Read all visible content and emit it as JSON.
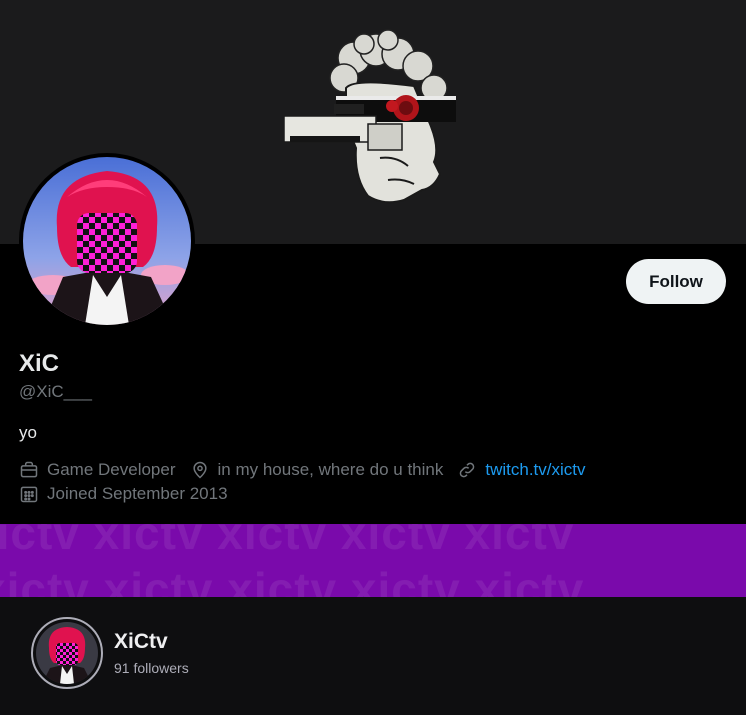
{
  "profile": {
    "display_name": "XiC",
    "handle": "@XiC___",
    "bio": "yo",
    "follow_label": "Follow",
    "profession": "Game Developer",
    "location": "in my house, where do u think",
    "link_text": "twitch.tv/xictv",
    "joined": "Joined September 2013",
    "icons": [
      "briefcase-icon",
      "location-pin-icon",
      "link-icon",
      "calendar-icon"
    ]
  },
  "twitch": {
    "watermark_text": "xictv xictv xictv xictv xictv",
    "channel_name": "XiCtv",
    "followers": "91 followers"
  },
  "colors": {
    "background": "#000000",
    "banner": "#1b1b1c",
    "follow_button_bg": "#eff3f4",
    "link": "#1d9bf0",
    "muted_text": "#71767b",
    "twitch_purple": "#7a0aab",
    "twitch_panel": "#0e0e10"
  }
}
